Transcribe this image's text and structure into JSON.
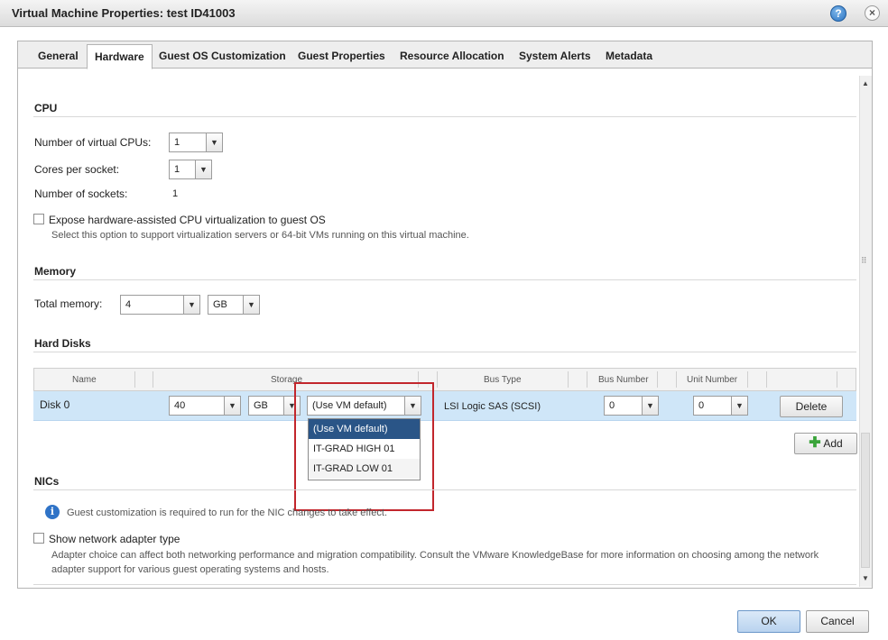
{
  "window": {
    "title": "Virtual Machine Properties: test ID41003",
    "help_icon": "?",
    "close_icon": "×"
  },
  "tabs": [
    "General",
    "Hardware",
    "Guest OS Customization",
    "Guest Properties",
    "Resource Allocation",
    "System Alerts",
    "Metadata"
  ],
  "active_tab": "Hardware",
  "cpu": {
    "title": "CPU",
    "num_vcpus_label": "Number of virtual CPUs:",
    "num_vcpus_value": "1",
    "cores_label": "Cores per socket:",
    "cores_value": "1",
    "sockets_label": "Number of sockets:",
    "sockets_value": "1",
    "expose_label": "Expose hardware-assisted CPU virtualization to guest OS",
    "expose_help": "Select this option to support virtualization servers or 64-bit VMs running on this virtual machine."
  },
  "memory": {
    "title": "Memory",
    "total_label": "Total memory:",
    "total_value": "4",
    "unit_value": "GB"
  },
  "hard_disks": {
    "title": "Hard Disks",
    "columns": [
      "Name",
      "Storage",
      "Bus Type",
      "Bus Number",
      "Unit Number"
    ],
    "rows": [
      {
        "name": "Disk 0",
        "size": "40",
        "size_unit": "GB",
        "storage_policy": "(Use VM default)",
        "bus_type": "LSI Logic SAS (SCSI)",
        "bus_number": "0",
        "unit_number": "0",
        "delete_label": "Delete"
      }
    ],
    "storage_options": [
      "(Use VM default)",
      "IT-GRAD HIGH 01",
      "IT-GRAD LOW 01"
    ],
    "add_label": "Add"
  },
  "nics": {
    "title": "NICs",
    "info_text": "Guest customization is required to run for the NIC changes to take effect.",
    "show_adapter_label": "Show network adapter type",
    "adapter_help": "Adapter choice can affect both networking performance and migration compatibility. Consult the VMware KnowledgeBase for more information on choosing among the network adapter support for various guest operating systems and hosts."
  },
  "footer": {
    "ok_label": "OK",
    "cancel_label": "Cancel"
  }
}
